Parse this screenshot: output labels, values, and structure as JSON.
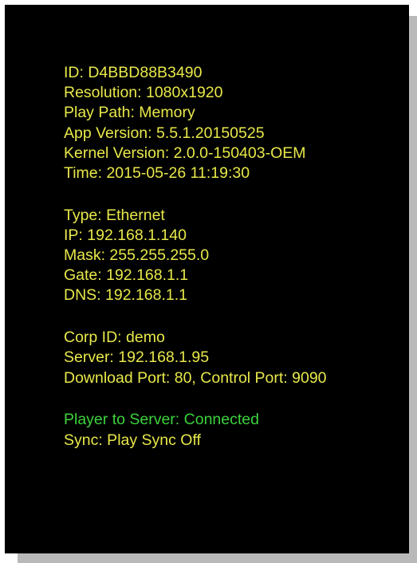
{
  "device_info": {
    "id": "ID: D4BBD88B3490",
    "resolution": "Resolution: 1080x1920",
    "play_path": "Play Path: Memory",
    "app_version": "App Version: 5.5.1.20150525",
    "kernel_version": "Kernel Version: 2.0.0-150403-OEM",
    "time": "Time: 2015-05-26 11:19:30"
  },
  "network": {
    "type": "Type: Ethernet",
    "ip": "IP: 192.168.1.140",
    "mask": "Mask: 255.255.255.0",
    "gate": "Gate: 192.168.1.1",
    "dns": "DNS: 192.168.1.1"
  },
  "server": {
    "corp_id": "Corp ID: demo",
    "server": "Server: 192.168.1.95",
    "ports": "Download Port: 80, Control Port: 9090"
  },
  "status": {
    "connection": "Player to Server: Connected",
    "sync": "Sync: Play Sync Off"
  },
  "colors": {
    "background": "#000000",
    "text": "#e8e84a",
    "connected": "#3cd23c",
    "shadow": "#b9b9b9"
  }
}
